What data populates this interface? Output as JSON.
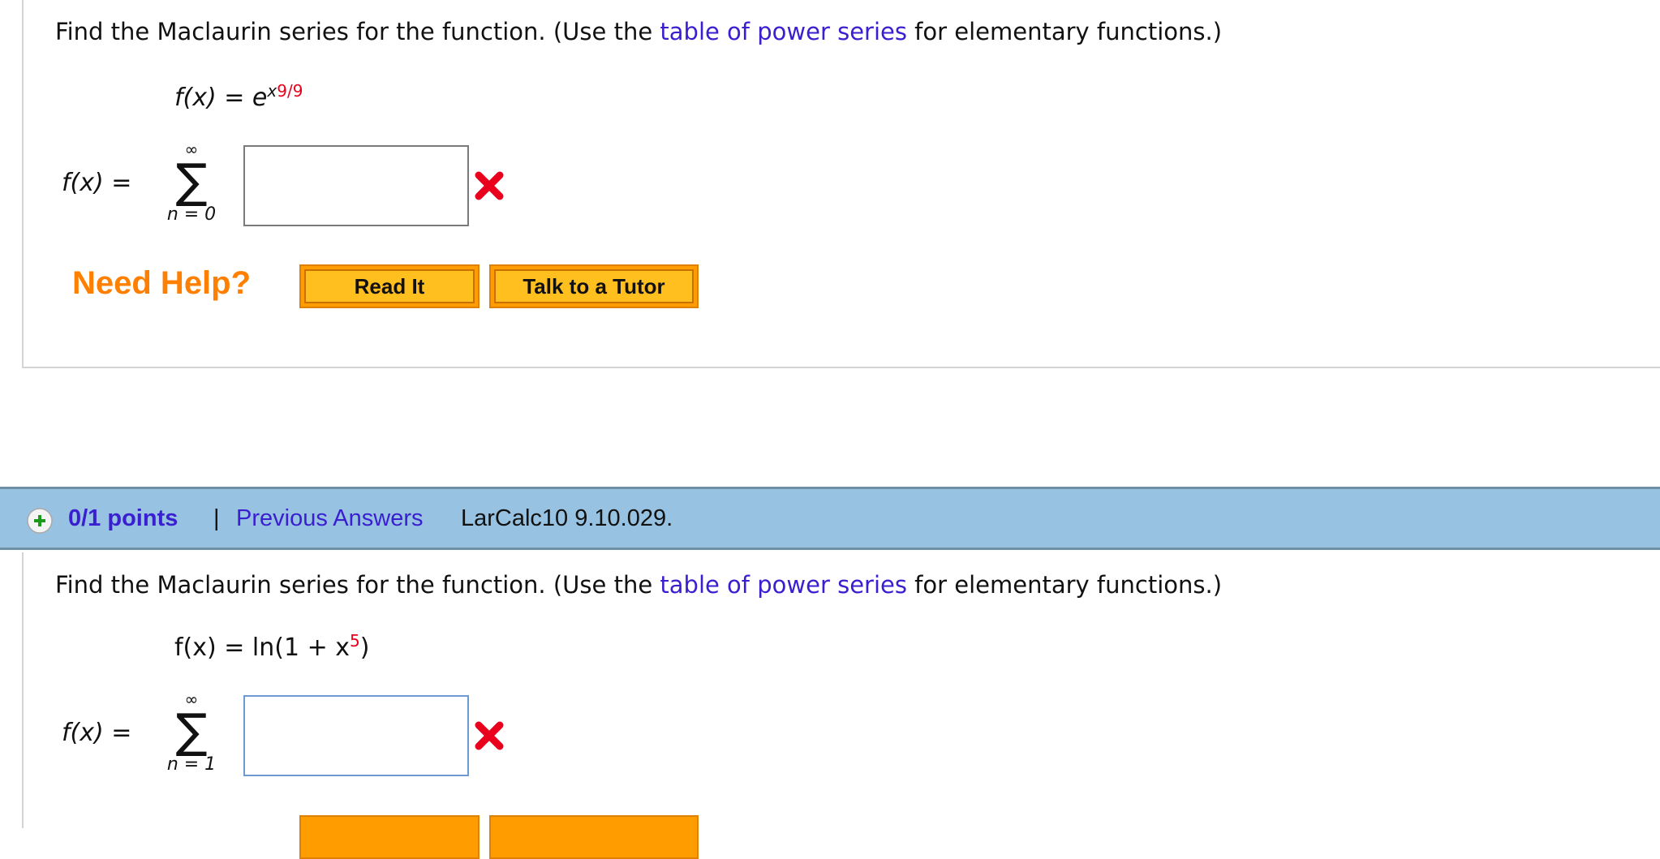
{
  "q1": {
    "prompt_pre": "Find the Maclaurin series for the function. (Use the ",
    "prompt_link": "table of power series",
    "prompt_post": " for elementary functions.)",
    "fx_label": "f(x) = e",
    "exp_base": "x",
    "exp_power": "9",
    "exp_div": "/9",
    "sum_lhs": "f(x) =",
    "sum_upper": "∞",
    "sum_lower": "n = 0",
    "answer_value": "",
    "status": "incorrect",
    "need_help": "Need Help?",
    "read_it": "Read It",
    "talk_tutor": "Talk to a Tutor"
  },
  "header": {
    "points": "0/1 points",
    "separator": "|",
    "previous_answers": "Previous Answers",
    "problem_id": "LarCalc10 9.10.029."
  },
  "q2": {
    "prompt_pre": "Find the Maclaurin series for the function. (Use the ",
    "prompt_link": "table of power series",
    "prompt_post": " for elementary functions.)",
    "fx_label": "f(x) = ln(1 + x",
    "exp_power": "5",
    "fx_close": ")",
    "sum_lhs": "f(x) =",
    "sum_upper": "∞",
    "sum_lower": "n = 1",
    "answer_value": "",
    "status": "incorrect"
  },
  "colors": {
    "link": "#3a1fd1",
    "help": "#ff7f00",
    "header_bg": "#97c2e1",
    "error": "#e8001c"
  }
}
